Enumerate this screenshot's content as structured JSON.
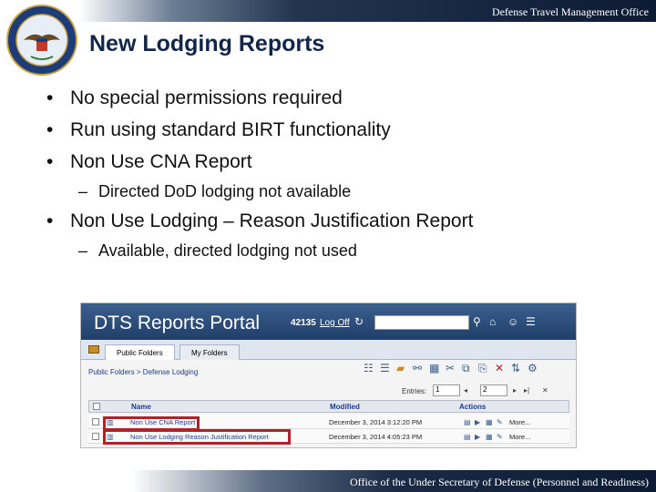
{
  "header": {
    "office": "Defense Travel Management Office"
  },
  "slide": {
    "title": "New Lodging Reports",
    "bullets": [
      "No special permissions required",
      "Run using standard BIRT functionality",
      "Non Use CNA Report",
      "Non Use Lodging – Reason Justification Report"
    ],
    "sub_bullets": [
      "Directed DoD lodging not available",
      "Available, directed lodging not used"
    ]
  },
  "portal": {
    "title": "DTS Reports Portal",
    "user_id": "42135",
    "logoff": "Log Off",
    "tabs": [
      "Public Folders",
      "My Folders"
    ],
    "breadcrumb": "Public Folders > Defense Lodging",
    "entries_label": "Entries:",
    "entries_value": "1",
    "page_value": "2",
    "columns": {
      "name": "Name",
      "modified": "Modified",
      "actions": "Actions"
    },
    "rows": [
      {
        "name": "Non Use CNA Report",
        "modified": "December 3, 2014 3:12:20 PM",
        "more": "More..."
      },
      {
        "name": "Non Use Lodging Reason Justification Report",
        "modified": "December 3, 2014 4:05:23 PM",
        "more": "More..."
      }
    ],
    "accent_color": "#b3202a",
    "header_color": "#2c4a78"
  },
  "footer": {
    "text": "Office of the Under Secretary of Defense (Personnel and Readiness)"
  }
}
